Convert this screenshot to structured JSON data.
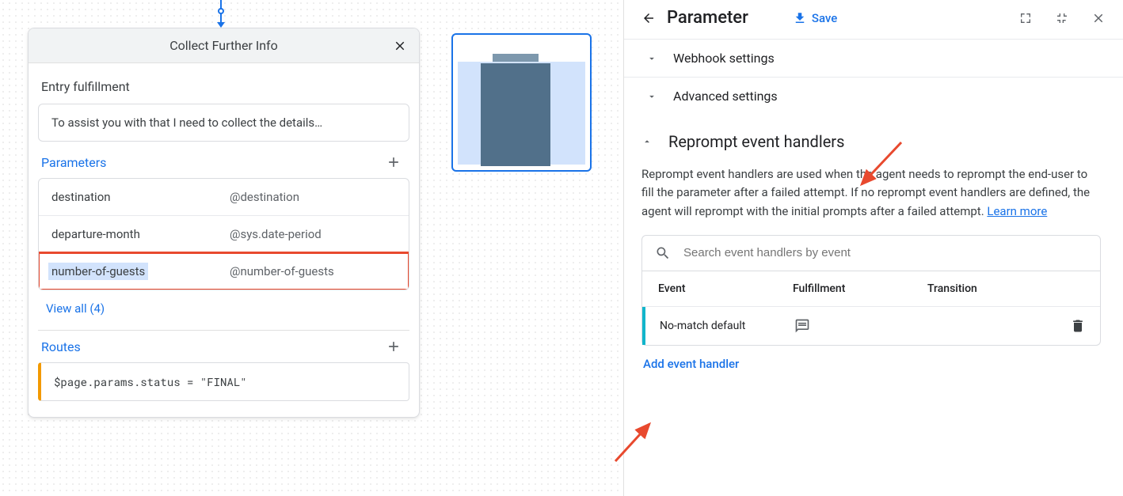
{
  "flow": {
    "title": "Collect Further Info",
    "entry_label": "Entry fulfillment",
    "entry_text": "To assist you with that I need to collect the details…",
    "parameters_label": "Parameters",
    "params": [
      {
        "name": "destination",
        "type": "@destination"
      },
      {
        "name": "departure-month",
        "type": "@sys.date-period"
      },
      {
        "name": "number-of-guests",
        "type": "@number-of-guests"
      }
    ],
    "view_all": "View all (4)",
    "routes_label": "Routes",
    "route_cond": "$page.params.status = \"FINAL\""
  },
  "panel": {
    "title": "Parameter",
    "save": "Save",
    "sections": {
      "webhook": "Webhook settings",
      "advanced": "Advanced settings",
      "reprompt_title": "Reprompt event handlers",
      "reprompt_desc": "Reprompt event handlers are used when the agent needs to reprompt the end-user to fill the parameter after a failed attempt. If no reprompt event handlers are defined, the agent will reprompt with the initial prompts after a failed attempt. ",
      "learn_more": "Learn more",
      "search_placeholder": "Search event handlers by event",
      "col_event": "Event",
      "col_fulfillment": "Fulfillment",
      "col_transition": "Transition",
      "row_event": "No-match default",
      "add_handler": "Add event handler"
    }
  }
}
